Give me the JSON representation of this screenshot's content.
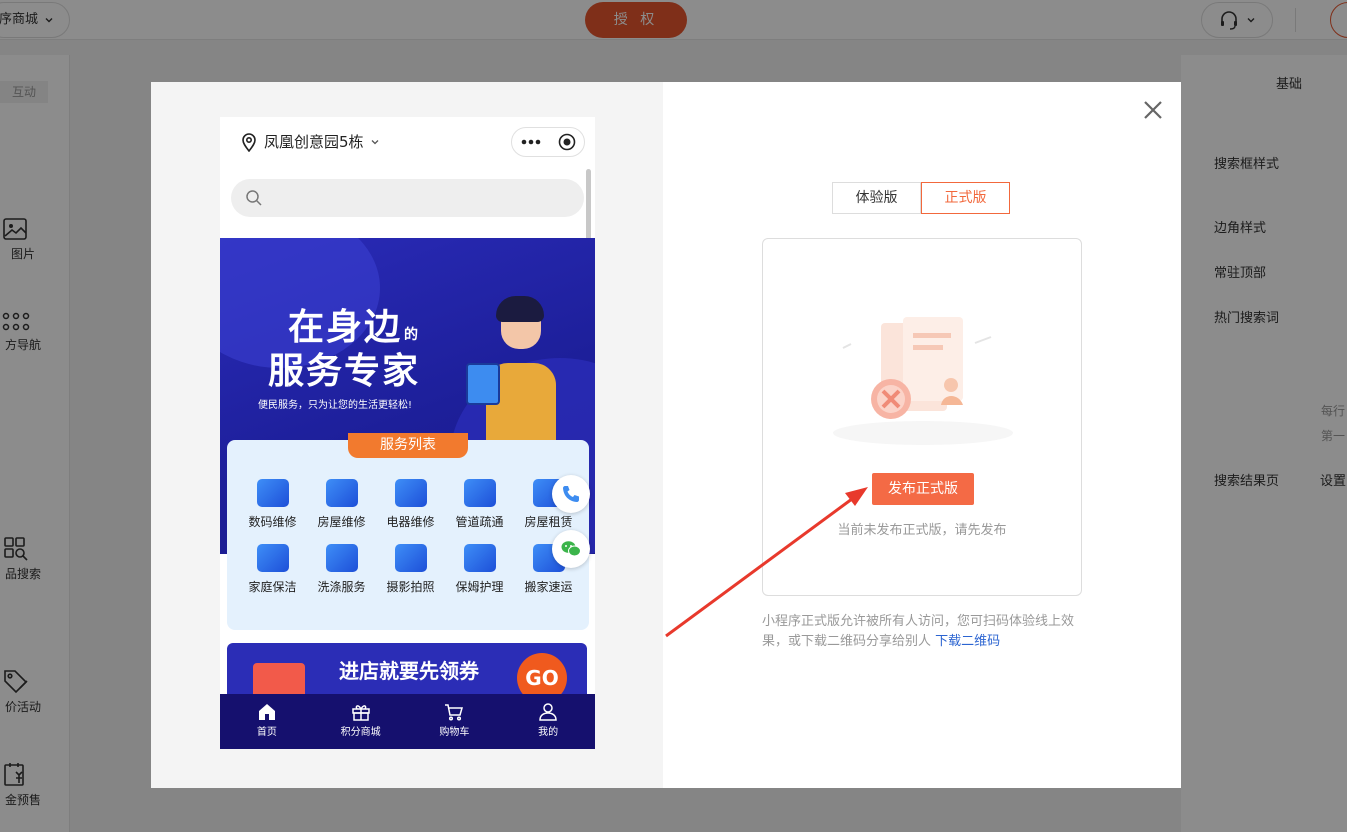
{
  "background": {
    "store_select": "序商城",
    "auth_button": "授 权",
    "left_tab": "互动",
    "left_items": [
      "图片",
      "方导航",
      "品搜索",
      "价活动",
      "金预售"
    ],
    "right_panel": {
      "header": "基础",
      "search_style_label": "搜索框样式",
      "corner_style_label": "边角样式",
      "pin_top_label": "常驻顶部",
      "hot_words_label": "热门搜索词",
      "note_line1": "每行",
      "note_line2": "第一",
      "result_page_label": "搜索结果页",
      "result_page_value": "设置"
    }
  },
  "phone": {
    "location": "凤凰创意园5栋",
    "banner": {
      "title_line1": "在身边",
      "title_small": "的",
      "title_line2": "服务专家",
      "subtitle": "便民服务，只为让您的生活更轻松!"
    },
    "service_ribbon": "服务列表",
    "services": [
      "数码维修",
      "房屋维修",
      "电器维修",
      "管道疏通",
      "房屋租赁",
      "家庭保洁",
      "洗涤服务",
      "摄影拍照",
      "保姆护理",
      "搬家速运"
    ],
    "promo_text": "进店就要先领券",
    "promo_go": "GO",
    "tabs": [
      "首页",
      "积分商城",
      "购物车",
      "我的"
    ]
  },
  "publish": {
    "tab_trial": "体验版",
    "tab_formal": "正式版",
    "publish_button": "发布正式版",
    "hint": "当前未发布正式版，请先发布",
    "note": "小程序正式版允许被所有人访问，您可扫码体验线上效果，或下载二维码分享给别人",
    "download_link": "下载二维码"
  },
  "colors": {
    "accent": "#f46a45",
    "auth": "#e8562f",
    "tabbar": "#15106e",
    "link": "#2b64d1"
  }
}
